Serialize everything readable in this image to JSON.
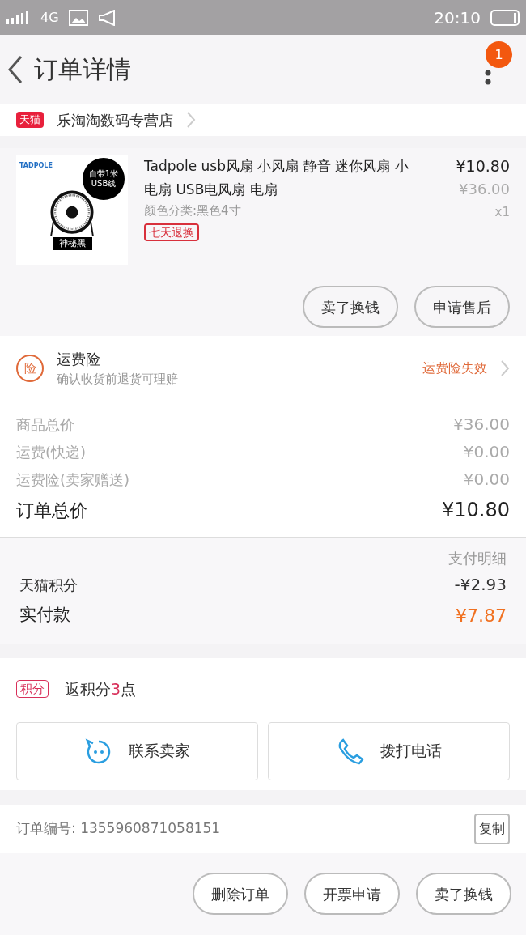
{
  "status_bar": {
    "network": "4G",
    "time": "20:10"
  },
  "header": {
    "title": "订单详情",
    "badge": "1"
  },
  "store": {
    "badge": "天猫",
    "name": "乐淘淘数码专营店"
  },
  "product": {
    "image_brand": "TADPOLE",
    "image_tag": "自带1米USB线",
    "image_caption": "神秘黑",
    "title": "Tadpole usb风扇 小风扇 静音 迷你风扇 小电扇 USB电风扇 电扇",
    "variant": "颜色分类:黑色4寸",
    "tag": "七天退换",
    "price": "¥10.80",
    "original_price": "¥36.00",
    "quantity": "x1",
    "buttons": [
      "卖了换钱",
      "申请售后"
    ]
  },
  "insurance": {
    "icon_text": "险",
    "title": "运费险",
    "subtitle": "确认收货前退货可理赔",
    "status": "运费险失效"
  },
  "summary": [
    {
      "label": "商品总价",
      "value": "¥36.00",
      "kind": "minor"
    },
    {
      "label": "运费(快递)",
      "value": "¥0.00",
      "kind": "minor"
    },
    {
      "label": "运费险(卖家赠送)",
      "value": "¥0.00",
      "kind": "minor"
    },
    {
      "label": "订单总价",
      "value": "¥10.80",
      "kind": "total"
    }
  ],
  "payment": {
    "link": "支付明细",
    "rows": [
      {
        "label": "天猫积分",
        "value": "-¥2.93",
        "kind": "plain"
      },
      {
        "label": "实付款",
        "value": "¥7.87",
        "kind": "paid"
      }
    ]
  },
  "points": {
    "badge": "积分",
    "before": "返积分",
    "number": "3",
    "after": "点"
  },
  "contact_buttons": [
    {
      "label": "联系卖家",
      "kind": "chat"
    },
    {
      "label": "拨打电话",
      "kind": "phone"
    }
  ],
  "order": {
    "label": "订单编号: 1355960871058151",
    "copy": "复制"
  },
  "bottom_buttons": [
    "删除订单",
    "开票申请",
    "卖了换钱"
  ]
}
